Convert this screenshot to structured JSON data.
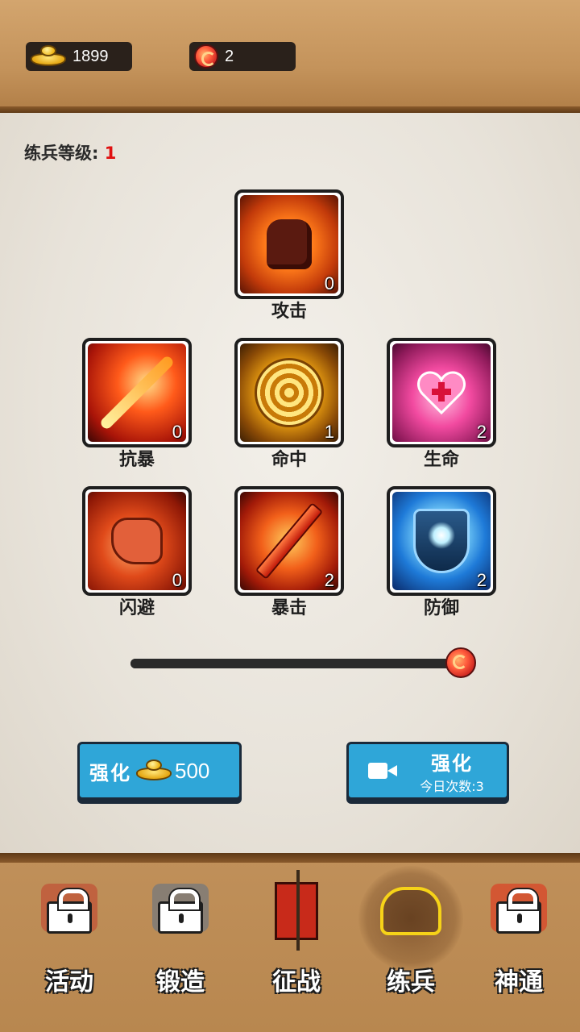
{
  "resources": {
    "gold": "1899",
    "orbs": "2"
  },
  "level": {
    "label": "练兵等级:",
    "value": "1"
  },
  "skills": [
    {
      "name": "攻击",
      "count": "0",
      "icon": "fist-icon"
    },
    {
      "name": "抗暴",
      "count": "0",
      "icon": "flaming-arrow-icon"
    },
    {
      "name": "命中",
      "count": "1",
      "icon": "target-icon"
    },
    {
      "name": "生命",
      "count": "2",
      "icon": "heart-plus-icon"
    },
    {
      "name": "闪避",
      "count": "0",
      "icon": "winged-boot-icon"
    },
    {
      "name": "暴击",
      "count": "2",
      "icon": "fire-sword-icon"
    },
    {
      "name": "防御",
      "count": "2",
      "icon": "shield-icon"
    }
  ],
  "slider": {
    "value_fraction": 1.0
  },
  "buttons": {
    "upgrade_gold": {
      "label": "强化",
      "cost": "500"
    },
    "upgrade_video": {
      "label": "强化",
      "sub": "今日次数:3"
    }
  },
  "nav": [
    {
      "label": "活动",
      "locked": true,
      "icon": "activity-icon"
    },
    {
      "label": "锻造",
      "locked": true,
      "icon": "anvil-hammer-icon"
    },
    {
      "label": "征战",
      "locked": false,
      "icon": "battle-banner-icon"
    },
    {
      "label": "练兵",
      "locked": false,
      "active": true,
      "icon": "war-horse-icon"
    },
    {
      "label": "神通",
      "locked": true,
      "icon": "mask-icon"
    }
  ],
  "colors": {
    "accent_button": "#2fa6d8",
    "level_value": "#e01010",
    "active_nav_icon": "#f6d318"
  }
}
